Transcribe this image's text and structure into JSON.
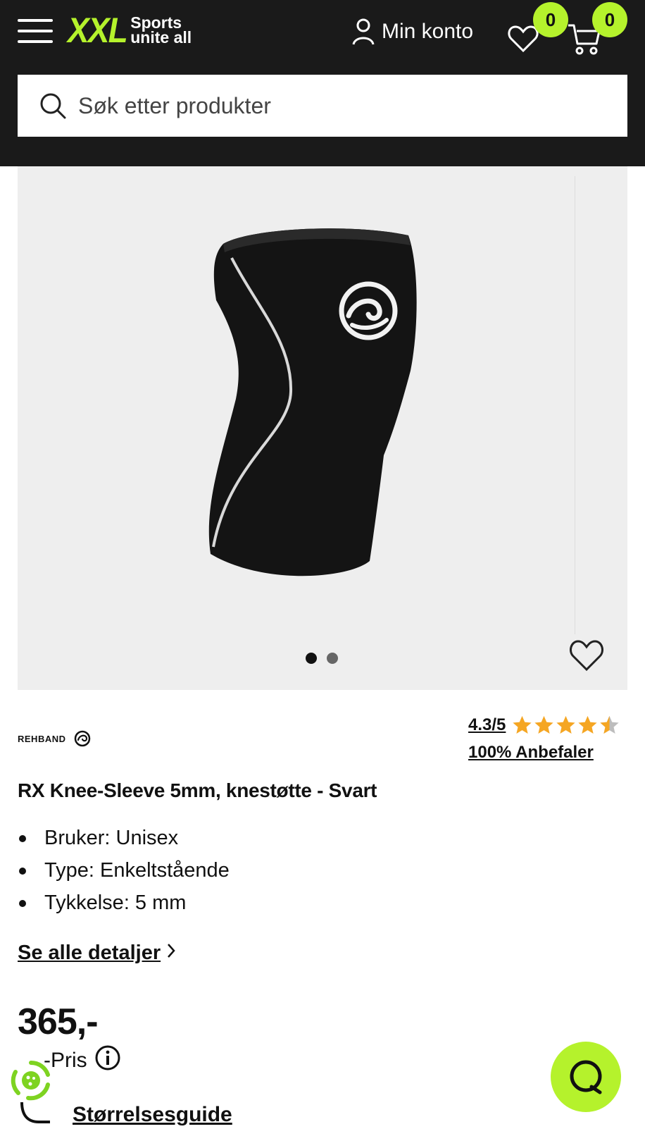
{
  "header": {
    "menu_icon": "hamburger-icon",
    "logo_text": "XXL",
    "logo_tagline_1": "Sports",
    "logo_tagline_2": "unite all",
    "account_label": "Min konto",
    "wishlist_count": "0",
    "cart_count": "0",
    "accent_color": "#b5f22c",
    "background_color": "#1a1a1a"
  },
  "search": {
    "placeholder": "Søk etter produkter"
  },
  "gallery": {
    "image_alt": "RX Knee-Sleeve 5mm black knee sleeve",
    "current_slide": 1,
    "total_slides": 2
  },
  "product": {
    "brand": "REHBAND",
    "rating_score": "4.3/5",
    "rating_value": 4.3,
    "rating_max": 5,
    "recommend_text": "100% Anbefaler",
    "title": "RX Knee-Sleeve 5mm, knestøtte - Svart",
    "features": [
      "Bruker: Unisex",
      "Type: Enkeltstående",
      "Tykkelse: 5 mm"
    ],
    "details_link": "Se alle detaljer",
    "price": "365,-",
    "price_type": "-Pris",
    "size_guide": "Størrelsesguide"
  }
}
